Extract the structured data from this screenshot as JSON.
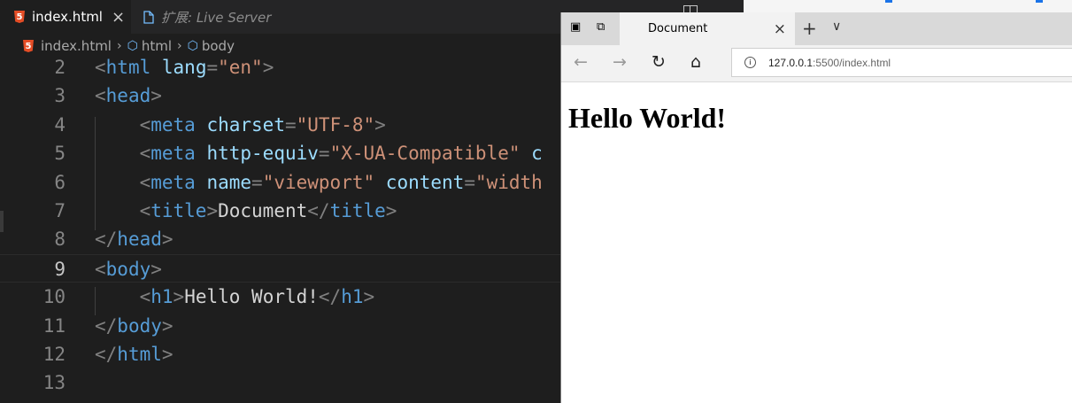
{
  "editor": {
    "tabs": [
      {
        "label": "index.html"
      },
      {
        "label": "扩展: Live Server"
      }
    ],
    "close_glyph": "×",
    "breadcrumbs": [
      "index.html",
      "html",
      "body"
    ],
    "lines": [
      {
        "number": "2",
        "tokens": [
          [
            "punc",
            "<"
          ],
          [
            "tag",
            "html"
          ],
          [
            "txt",
            " "
          ],
          [
            "attr",
            "lang"
          ],
          [
            "punc",
            "="
          ],
          [
            "str",
            "\"en\""
          ],
          [
            "punc",
            ">"
          ]
        ]
      },
      {
        "number": "3",
        "tokens": [
          [
            "punc",
            "<"
          ],
          [
            "tag",
            "head"
          ],
          [
            "punc",
            ">"
          ]
        ]
      },
      {
        "number": "4",
        "tokens": [
          [
            "txt",
            "    "
          ],
          [
            "punc",
            "<"
          ],
          [
            "tag",
            "meta"
          ],
          [
            "txt",
            " "
          ],
          [
            "attr",
            "charset"
          ],
          [
            "punc",
            "="
          ],
          [
            "str",
            "\"UTF-8\""
          ],
          [
            "punc",
            ">"
          ]
        ]
      },
      {
        "number": "5",
        "tokens": [
          [
            "txt",
            "    "
          ],
          [
            "punc",
            "<"
          ],
          [
            "tag",
            "meta"
          ],
          [
            "txt",
            " "
          ],
          [
            "attr",
            "http-equiv"
          ],
          [
            "punc",
            "="
          ],
          [
            "str",
            "\"X-UA-Compatible\""
          ],
          [
            "txt",
            " "
          ],
          [
            "attr",
            "c"
          ]
        ]
      },
      {
        "number": "6",
        "tokens": [
          [
            "txt",
            "    "
          ],
          [
            "punc",
            "<"
          ],
          [
            "tag",
            "meta"
          ],
          [
            "txt",
            " "
          ],
          [
            "attr",
            "name"
          ],
          [
            "punc",
            "="
          ],
          [
            "str",
            "\"viewport\""
          ],
          [
            "txt",
            " "
          ],
          [
            "attr",
            "content"
          ],
          [
            "punc",
            "="
          ],
          [
            "str",
            "\"width"
          ]
        ]
      },
      {
        "number": "7",
        "tokens": [
          [
            "txt",
            "    "
          ],
          [
            "punc",
            "<"
          ],
          [
            "tag",
            "title"
          ],
          [
            "punc",
            ">"
          ],
          [
            "txt",
            "Document"
          ],
          [
            "punc",
            "</"
          ],
          [
            "tag",
            "title"
          ],
          [
            "punc",
            ">"
          ]
        ]
      },
      {
        "number": "8",
        "tokens": [
          [
            "punc",
            "</"
          ],
          [
            "tag",
            "head"
          ],
          [
            "punc",
            ">"
          ]
        ]
      },
      {
        "number": "9",
        "tokens": [
          [
            "punc",
            "<"
          ],
          [
            "tag",
            "body"
          ],
          [
            "punc",
            ">"
          ]
        ],
        "current": true
      },
      {
        "number": "10",
        "tokens": [
          [
            "txt",
            "    "
          ],
          [
            "punc",
            "<"
          ],
          [
            "tag",
            "h1"
          ],
          [
            "punc",
            ">"
          ],
          [
            "txt",
            "Hello World!"
          ],
          [
            "punc",
            "</"
          ],
          [
            "tag",
            "h1"
          ],
          [
            "punc",
            ">"
          ]
        ]
      },
      {
        "number": "11",
        "tokens": [
          [
            "punc",
            "</"
          ],
          [
            "tag",
            "body"
          ],
          [
            "punc",
            ">"
          ]
        ]
      },
      {
        "number": "12",
        "tokens": [
          [
            "punc",
            "</"
          ],
          [
            "tag",
            "html"
          ],
          [
            "punc",
            ">"
          ]
        ]
      },
      {
        "number": "13",
        "tokens": []
      }
    ]
  },
  "browser": {
    "tab_title": "Document",
    "close_glyph": "×",
    "new_tab_glyph": "+",
    "tab_list_glyph": "∨",
    "back_glyph": "←",
    "forward_glyph": "→",
    "refresh_glyph": "↻",
    "home_glyph": "⌂",
    "url_host": "127.0.0.1",
    "url_rest": ":5500/index.html",
    "info_glyph": "i",
    "page_heading": "Hello World!"
  },
  "colors": {
    "tag": "#569cd6",
    "attr": "#9cdcfe",
    "string": "#ce9178",
    "punctuation": "#808080",
    "text": "#d4d4d4",
    "html5_badge": "#e44d26"
  }
}
